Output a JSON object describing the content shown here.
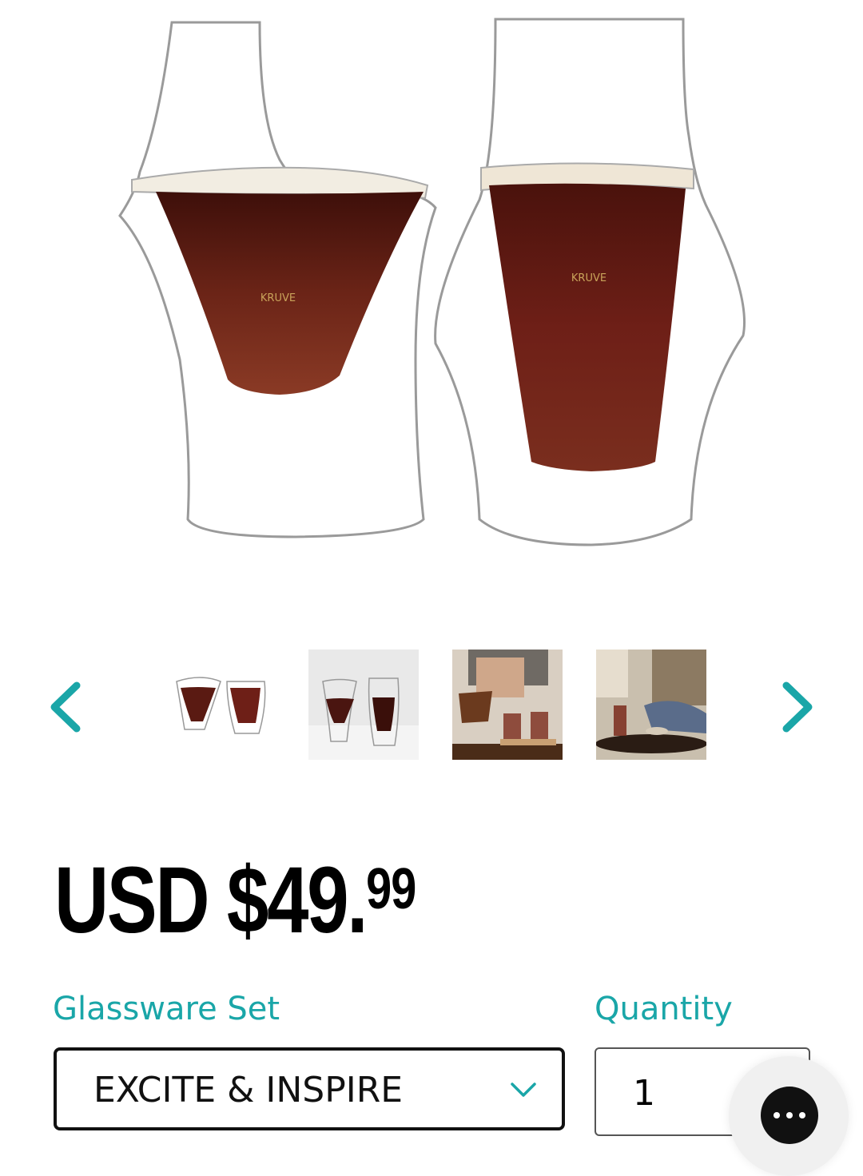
{
  "product": {
    "gallery": {
      "brand_mark": "KRUVE",
      "thumbnail_count": 4,
      "prev_icon": "chevron-left-icon",
      "next_icon": "chevron-right-icon"
    },
    "price": {
      "main": "USD $49.",
      "cents": "99"
    },
    "options": {
      "set_label": "Glassware Set",
      "set_value": "EXCITE & INSPIRE",
      "quantity_label": "Quantity",
      "quantity_value": "1"
    },
    "chat_icon": "chat-bubble-icon"
  },
  "colors": {
    "accent": "#1aa6a8",
    "text": "#000000",
    "coffee": "#5a1a12"
  }
}
